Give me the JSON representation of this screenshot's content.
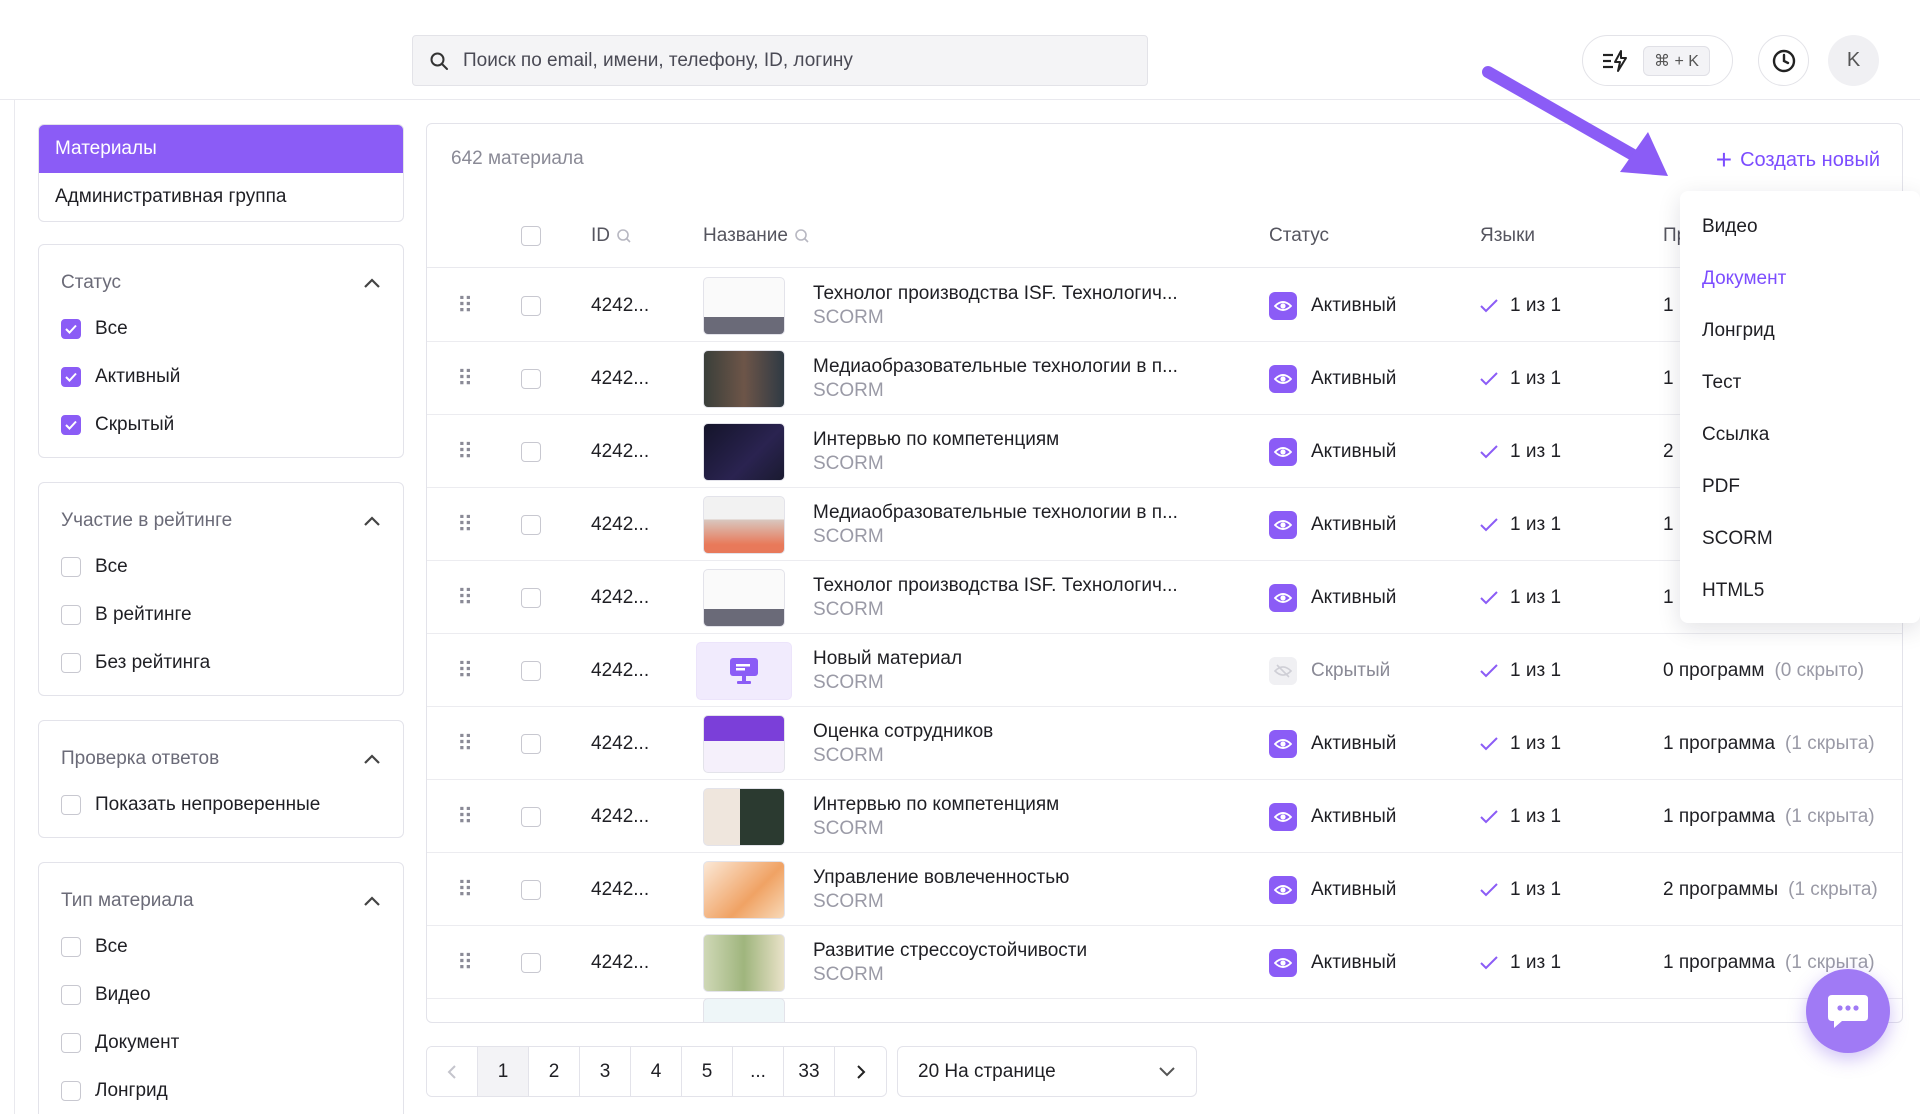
{
  "header": {
    "search_placeholder": "Поиск по email, имени, телефону, ID, логину",
    "shortcut": "⌘ + K",
    "avatar_initial": "K"
  },
  "sidebar": {
    "menu": [
      {
        "label": "Материалы",
        "active": true
      },
      {
        "label": "Административная группа",
        "active": false
      }
    ],
    "filters": {
      "status": {
        "title": "Статус",
        "options": [
          {
            "label": "Все",
            "checked": true
          },
          {
            "label": "Активный",
            "checked": true
          },
          {
            "label": "Скрытый",
            "checked": true
          }
        ]
      },
      "rating": {
        "title": "Участие в рейтинге",
        "options": [
          {
            "label": "Все",
            "checked": false
          },
          {
            "label": "В рейтинге",
            "checked": false
          },
          {
            "label": "Без рейтинга",
            "checked": false
          }
        ]
      },
      "answers": {
        "title": "Проверка ответов",
        "options": [
          {
            "label": "Показать непроверенные",
            "checked": false
          }
        ]
      },
      "type": {
        "title": "Тип материала",
        "options": [
          {
            "label": "Все",
            "checked": false
          },
          {
            "label": "Видео",
            "checked": false
          },
          {
            "label": "Документ",
            "checked": false
          },
          {
            "label": "Лонгрид",
            "checked": false
          }
        ]
      }
    }
  },
  "table": {
    "count_label": "642 материала",
    "create_label": "Создать новый",
    "columns": {
      "id": "ID",
      "name": "Название",
      "status": "Статус",
      "langs": "Языки",
      "programs": "Пр"
    },
    "rows": [
      {
        "id": "4242...",
        "title": "Технолог производства ISF. Технологич...",
        "type": "SCORM",
        "status": "Активный",
        "hidden": false,
        "langs": "1 из 1",
        "programs": "1",
        "programs_extra": "",
        "thumb": "white"
      },
      {
        "id": "4242...",
        "title": "Медиаобразовательные технологии в п...",
        "type": "SCORM",
        "status": "Активный",
        "hidden": false,
        "langs": "1 из 1",
        "programs": "1",
        "programs_extra": "",
        "thumb": "people"
      },
      {
        "id": "4242...",
        "title": "Интервью по компетенциям",
        "type": "SCORM",
        "status": "Активный",
        "hidden": false,
        "langs": "1 из 1",
        "programs": "2",
        "programs_extra": "",
        "thumb": "dark"
      },
      {
        "id": "4242...",
        "title": "Медиаобразовательные технологии в п...",
        "type": "SCORM",
        "status": "Активный",
        "hidden": false,
        "langs": "1 из 1",
        "programs": "1",
        "programs_extra": "",
        "thumb": "office"
      },
      {
        "id": "4242...",
        "title": "Технолог производства ISF. Технологич...",
        "type": "SCORM",
        "status": "Активный",
        "hidden": false,
        "langs": "1 из 1",
        "programs": "1",
        "programs_extra": "",
        "thumb": "white"
      },
      {
        "id": "4242...",
        "title": "Новый материал",
        "type": "SCORM",
        "status": "Скрытый",
        "hidden": true,
        "langs": "1 из 1",
        "programs": "0 программ",
        "programs_extra": "(0 скрыто)",
        "thumb": "placeholder"
      },
      {
        "id": "4242...",
        "title": "Оценка сотрудников",
        "type": "SCORM",
        "status": "Активный",
        "hidden": false,
        "langs": "1 из 1",
        "programs": "1 программа",
        "programs_extra": "(1 скрыта)",
        "thumb": "purple"
      },
      {
        "id": "4242...",
        "title": "Интервью по компетенциям",
        "type": "SCORM",
        "status": "Активный",
        "hidden": false,
        "langs": "1 из 1",
        "programs": "1 программа",
        "programs_extra": "(1 скрыта)",
        "thumb": "man"
      },
      {
        "id": "4242...",
        "title": "Управление вовлеченностью",
        "type": "SCORM",
        "status": "Активный",
        "hidden": false,
        "langs": "1 из 1",
        "programs": "2 программы",
        "programs_extra": "(1 скрыта)",
        "thumb": "orange"
      },
      {
        "id": "4242...",
        "title": "Развитие стрессоустойчивости",
        "type": "SCORM",
        "status": "Активный",
        "hidden": false,
        "langs": "1 из 1",
        "programs": "1 программа",
        "programs_extra": "(1 скрыта)",
        "thumb": "green"
      }
    ]
  },
  "dropdown": {
    "items": [
      {
        "label": "Видео",
        "active": false
      },
      {
        "label": "Документ",
        "active": true
      },
      {
        "label": "Лонгрид",
        "active": false
      },
      {
        "label": "Тест",
        "active": false
      },
      {
        "label": "Ссылка",
        "active": false
      },
      {
        "label": "PDF",
        "active": false
      },
      {
        "label": "SCORM",
        "active": false
      },
      {
        "label": "HTML5",
        "active": false
      }
    ]
  },
  "pagination": {
    "pages": [
      "1",
      "2",
      "3",
      "4",
      "5",
      "...",
      "33"
    ],
    "current": "1",
    "per_page": "20 На странице"
  },
  "colors": {
    "accent": "#8b5cf6",
    "link": "#7c4dff"
  }
}
